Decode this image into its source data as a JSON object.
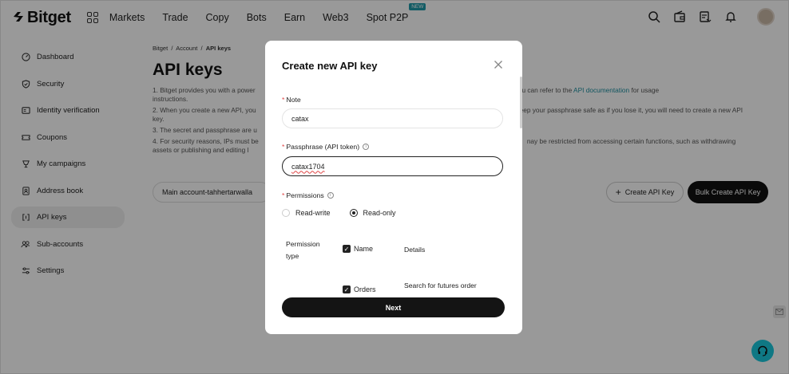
{
  "brand": {
    "name": "Bitget"
  },
  "nav": {
    "items": [
      "Markets",
      "Trade",
      "Copy",
      "Bots",
      "Earn",
      "Web3",
      "Spot P2P"
    ],
    "badge": "NEW"
  },
  "sidebar": {
    "items": [
      {
        "label": "Dashboard",
        "icon": "dashboard-icon"
      },
      {
        "label": "Security",
        "icon": "shield-icon"
      },
      {
        "label": "Identity verification",
        "icon": "id-card-icon"
      },
      {
        "label": "Coupons",
        "icon": "coupon-icon"
      },
      {
        "label": "My campaigns",
        "icon": "trophy-icon"
      },
      {
        "label": "Address book",
        "icon": "address-book-icon"
      },
      {
        "label": "API keys",
        "icon": "api-icon"
      },
      {
        "label": "Sub-accounts",
        "icon": "users-icon"
      },
      {
        "label": "Settings",
        "icon": "sliders-icon"
      }
    ],
    "active": "API keys"
  },
  "main": {
    "breadcrumb": {
      "home": "Bitget",
      "sep": "/",
      "account": "Account",
      "current": "API keys"
    },
    "title": "API keys",
    "notes": {
      "n1a": "1. Bitget provides you with a power",
      "n1b": "make withdrawals. You can refer to the",
      "n1link": "API documentation",
      "n1c": "for usage",
      "n1d": "instructions.",
      "n2a": "2. When you create a new API, you",
      "n2b": "eep your passphrase safe as if you lose it, you will need to create a new API",
      "n2c": "key.",
      "n3a": "3. The secret and passphrase are u",
      "n4a": "4. For security reasons, IPs must be",
      "n4b": "nay be restricted from accessing certain functions, such as withdrawing",
      "n4c": "assets or publishing and editing l"
    },
    "account_selector": "Main account-tahhertarwalla",
    "create_button": "Create API Key",
    "create_plus": "+",
    "bulk_button": "Bulk Create API Key"
  },
  "modal": {
    "title": "Create new API key",
    "note_label": "Note",
    "required_mark": "*",
    "note_value": "catax",
    "passphrase_label": "Passphrase (API token)",
    "passphrase_value": "catax1704",
    "permissions_label": "Permissions",
    "info_glyph": "i",
    "read_write": "Read-write",
    "read_only": "Read-only",
    "permission_type_1": "Permission",
    "permission_type_2": "type",
    "perm_name": "Name",
    "perm_details": "Details",
    "perm_orders": "Orders",
    "perm_orders_detail": "Search for futures order",
    "next_button": "Next"
  },
  "colors": {
    "accent": "#1e8fa0",
    "help": "#1ac8dd",
    "primary_button": "#111111",
    "required": "#e04545"
  }
}
